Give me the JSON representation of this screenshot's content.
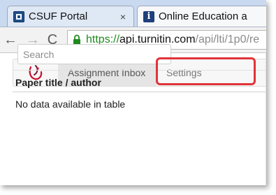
{
  "browser": {
    "tabs": [
      {
        "title": "CSUF Portal",
        "icon": "portal-icon",
        "close": "×"
      },
      {
        "title": "Online Education a",
        "icon": "info-icon",
        "close": ""
      }
    ],
    "toolbar": {
      "back": "←",
      "forward": "→",
      "reload": "C",
      "url_scheme": "https://",
      "url_host": "api.turnitin.com",
      "url_path": "/api/lti/1p0/re"
    }
  },
  "turnitin": {
    "nav": {
      "inbox_label": "Assignment Inbox",
      "settings_label": "Settings"
    },
    "search": {
      "placeholder": "Search",
      "value": ""
    },
    "table": {
      "column_header": "Paper title / author",
      "empty_message": "No data available in table"
    }
  },
  "colors": {
    "highlight": "#e0343a",
    "url_scheme": "#1f8a1f",
    "tabstrip": "#c9d9ef",
    "logo_red": "#c8102e"
  }
}
